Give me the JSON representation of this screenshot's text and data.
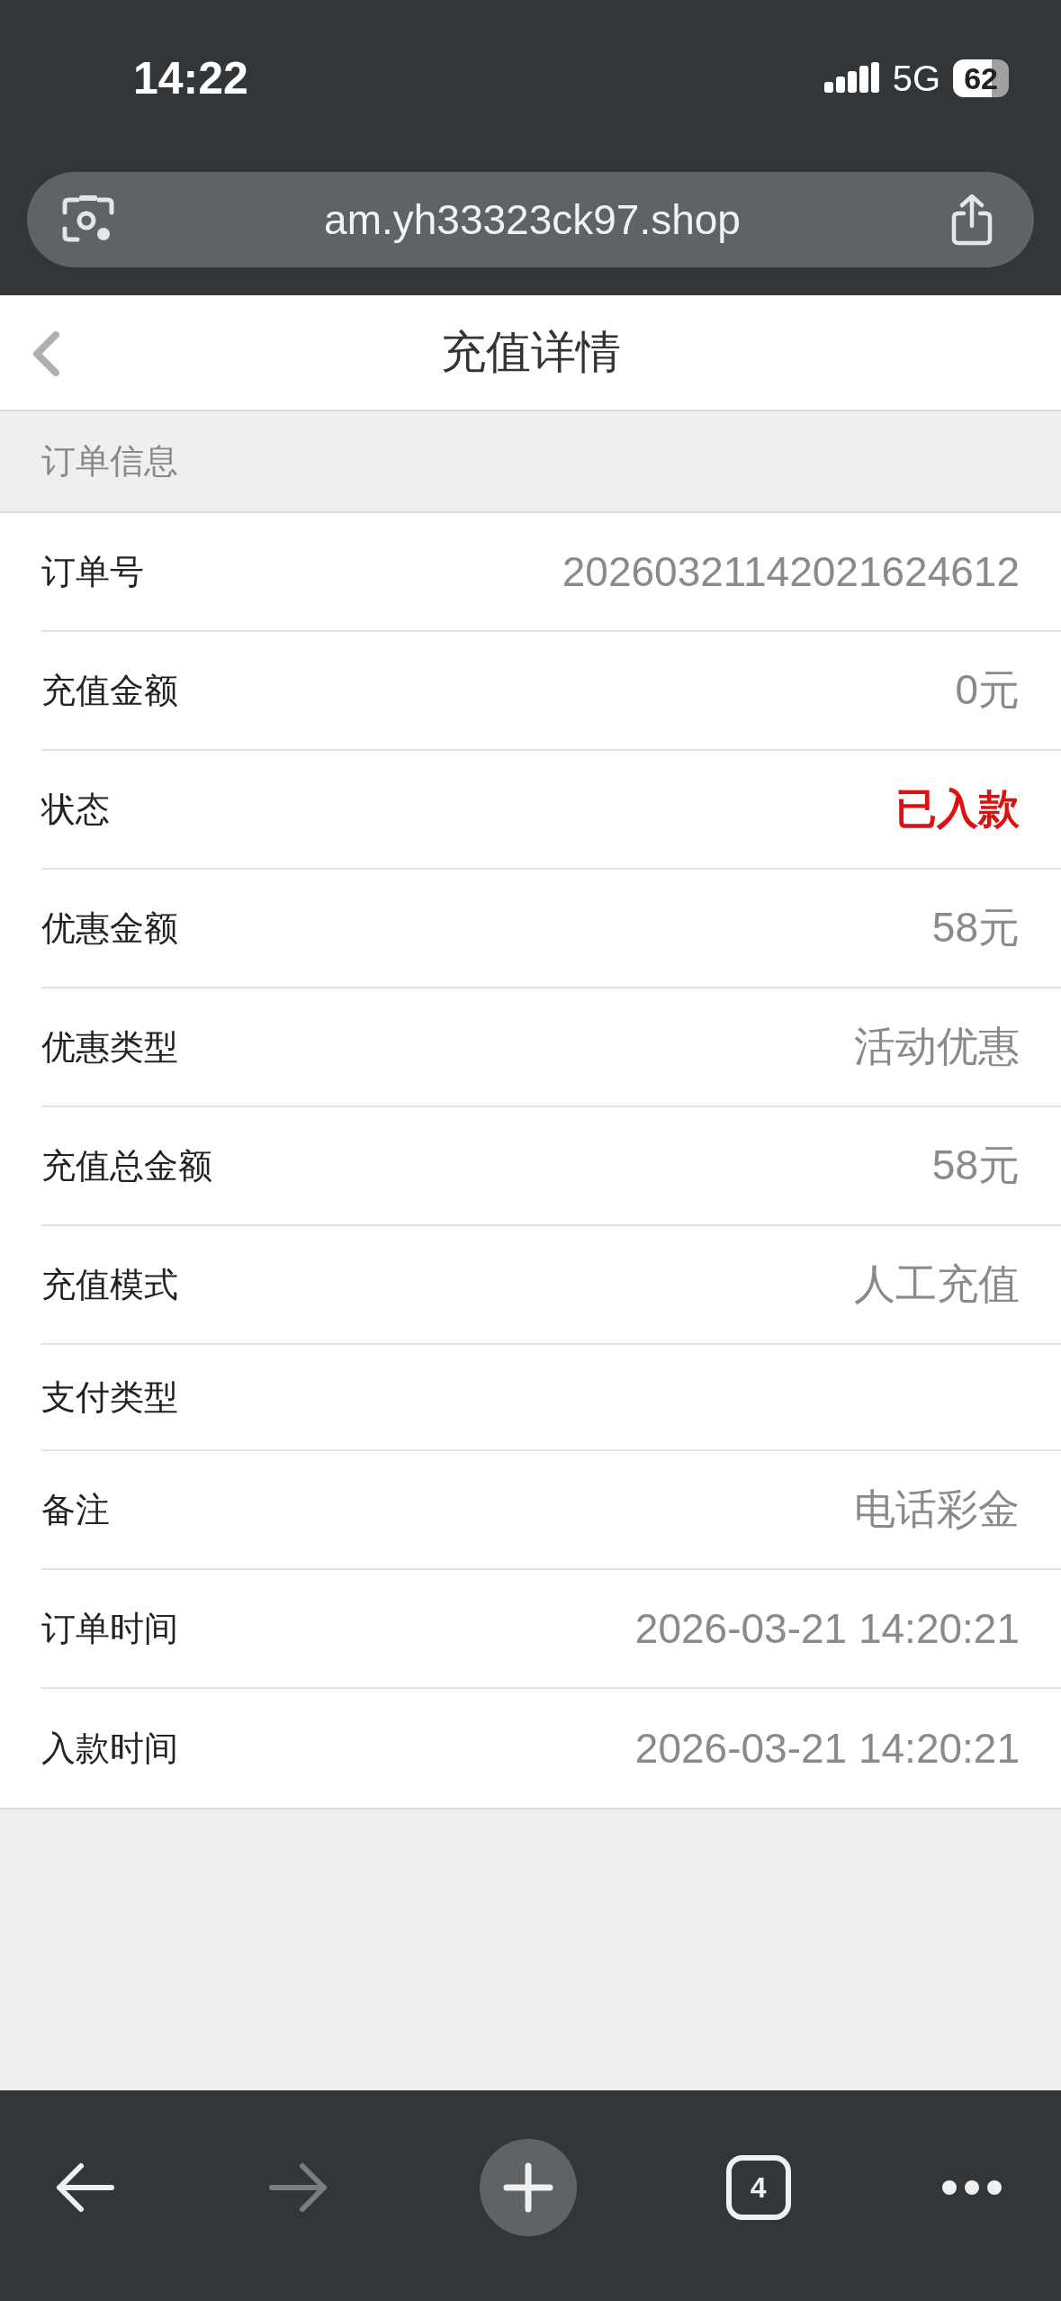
{
  "status_bar": {
    "time": "14:22",
    "network": "5G",
    "battery": "62"
  },
  "address_bar": {
    "url": "am.yh33323ck97.shop"
  },
  "header": {
    "title": "充值详情"
  },
  "section": {
    "title": "订单信息"
  },
  "rows": [
    {
      "label": "订单号",
      "value": "20260321142021624612",
      "emphasized": false
    },
    {
      "label": "充值金额",
      "value": "0元",
      "emphasized": false
    },
    {
      "label": "状态",
      "value": "已入款",
      "emphasized": true
    },
    {
      "label": "优惠金额",
      "value": "58元",
      "emphasized": false
    },
    {
      "label": "优惠类型",
      "value": "活动优惠",
      "emphasized": false
    },
    {
      "label": "充值总金额",
      "value": "58元",
      "emphasized": false
    },
    {
      "label": "充值模式",
      "value": "人工充值",
      "emphasized": false
    },
    {
      "label": "支付类型"
    },
    {
      "label": "备注",
      "value": "电话彩金",
      "emphasized": false
    },
    {
      "label": "订单时间",
      "value": "2026-03-21 14:20:21",
      "emphasized": false
    },
    {
      "label": "入款时间",
      "value": "2026-03-21 14:20:21",
      "emphasized": false
    }
  ],
  "toolbar": {
    "forward_disabled": true,
    "tab_count": "4"
  }
}
